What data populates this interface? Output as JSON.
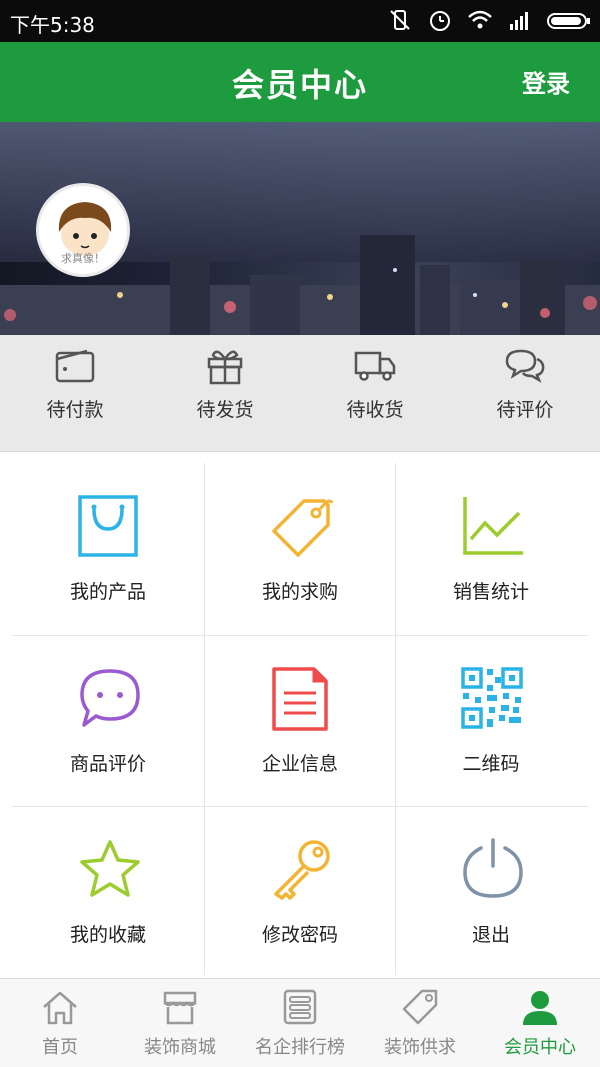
{
  "status_bar": {
    "time": "下午5:38"
  },
  "app_bar": {
    "title": "会员中心",
    "login_label": "登录"
  },
  "banner": {
    "avatar_caption": "求真像！"
  },
  "orders": [
    {
      "label": "待付款",
      "icon": "wallet-icon"
    },
    {
      "label": "待发货",
      "icon": "gift-icon"
    },
    {
      "label": "待收货",
      "icon": "truck-icon"
    },
    {
      "label": "待评价",
      "icon": "chat-bubbles-icon"
    }
  ],
  "grid": [
    {
      "label": "我的产品",
      "icon": "shopping-bag-icon",
      "color": "#2ab3e6"
    },
    {
      "label": "我的求购",
      "icon": "price-tag-icon",
      "color": "#f4b433"
    },
    {
      "label": "销售统计",
      "icon": "line-chart-icon",
      "color": "#9ccc2d"
    },
    {
      "label": "商品评价",
      "icon": "speech-bubble-icon",
      "color": "#9a5ad0"
    },
    {
      "label": "企业信息",
      "icon": "document-icon",
      "color": "#ef4b4b"
    },
    {
      "label": "二维码",
      "icon": "qr-code-icon",
      "color": "#2ab3e6"
    },
    {
      "label": "我的收藏",
      "icon": "star-icon",
      "color": "#9ccc2d"
    },
    {
      "label": "修改密码",
      "icon": "key-icon",
      "color": "#f4b433"
    },
    {
      "label": "退出",
      "icon": "power-icon",
      "color": "#7f93a8"
    }
  ],
  "bottom_nav": [
    {
      "label": "首页",
      "icon": "home-icon",
      "active": false
    },
    {
      "label": "装饰商城",
      "icon": "store-icon",
      "active": false
    },
    {
      "label": "名企排行榜",
      "icon": "list-icon",
      "active": false
    },
    {
      "label": "装饰供求",
      "icon": "tag-icon",
      "active": false
    },
    {
      "label": "会员中心",
      "icon": "user-icon",
      "active": true
    }
  ],
  "colors": {
    "brand_green": "#1f9b3f"
  }
}
